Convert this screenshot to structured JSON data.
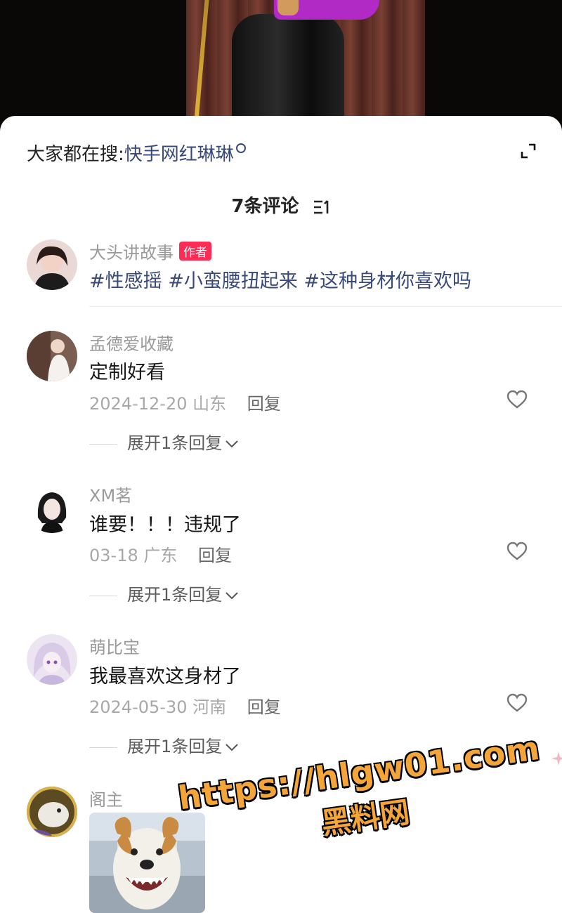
{
  "search": {
    "prefix": "大家都在搜:",
    "keyword": "快手网红琳琳"
  },
  "header": {
    "title": "7条评论"
  },
  "comments": [
    {
      "username": "大头讲故事",
      "badge": "作者",
      "text": "#性感摇 #小蛮腰扭起来 #这种身材你喜欢吗"
    },
    {
      "username": "孟德爱收藏",
      "text": "定制好看",
      "date": "2024-12-20",
      "location": "山东",
      "reply": "回复",
      "expand": "展开1条回复"
    },
    {
      "username": "XM茗",
      "text": "谁要！！！违规了",
      "date": "03-18",
      "location": "广东",
      "reply": "回复",
      "expand": "展开1条回复"
    },
    {
      "username": "萌比宝",
      "text": "我最喜欢这身材了",
      "date": "2024-05-30",
      "location": "河南",
      "reply": "回复",
      "expand": "展开1条回复"
    },
    {
      "username": "阁主"
    }
  ],
  "watermark": {
    "line1": "https://hlgw01.com",
    "line2": "黑料网"
  },
  "colors": {
    "accent": "#fe2c55",
    "link": "#3a4a78",
    "watermark": "#f4a53a"
  },
  "icons": [
    "search-icon",
    "expand-icon",
    "sort-icon",
    "heart-icon",
    "chevron-down-icon"
  ]
}
